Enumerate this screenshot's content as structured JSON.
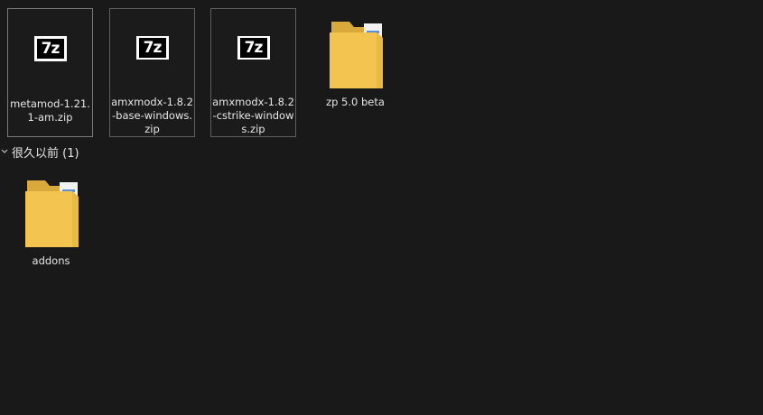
{
  "files": [
    {
      "name": "metamod-1.21.1-am.zip",
      "icon": "7zip-icon"
    },
    {
      "name": "amxmodx-1.8.2-base-windows.zip",
      "icon": "7zip-icon"
    },
    {
      "name": "amxmodx-1.8.2-cstrike-windows.zip",
      "icon": "7zip-icon"
    },
    {
      "name": "zp 5.0 beta",
      "icon": "folder-icon"
    }
  ],
  "group": {
    "label": "很久以前 (1)"
  },
  "group_items": [
    {
      "name": "addons",
      "icon": "folder-icon"
    }
  ],
  "zip_icon_text": "7z",
  "colors": {
    "background": "#191919",
    "text": "#e6e6e6",
    "folder_yellow": "#f3c550"
  }
}
